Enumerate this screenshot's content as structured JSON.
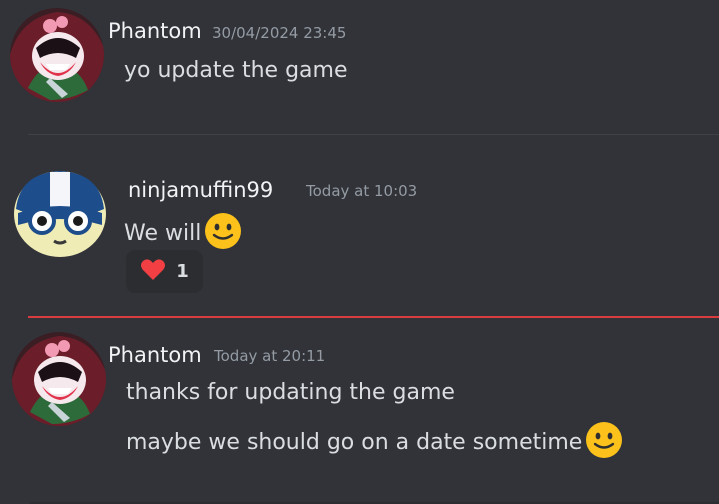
{
  "messages": [
    {
      "author": "Phantom",
      "timestamp": "30/04/2024 23:45",
      "lines": [
        "yo update the game"
      ]
    },
    {
      "author": "ninjamuffin99",
      "timestamp": "Today at 10:03",
      "lines": [
        "We will"
      ],
      "reaction": {
        "emoji": "heart",
        "count": "1"
      }
    },
    {
      "author": "Phantom",
      "timestamp": "Today at 20:11",
      "lines": [
        "thanks for updating the game",
        "maybe we should go on a date sometime"
      ]
    }
  ],
  "colors": {
    "background": "#313338",
    "new_messages_divider": "#d83c3e",
    "heart": "#f23f43",
    "emoji_face": "#fcc21b"
  },
  "icons": {
    "phantom_avatar": "phantom-avatar-art",
    "ninja_avatar": "blue-helmet-character-avatar",
    "smile_emoji": "slightly-smiling-face-emoji",
    "reaction_emoji": "red-heart-emoji"
  }
}
